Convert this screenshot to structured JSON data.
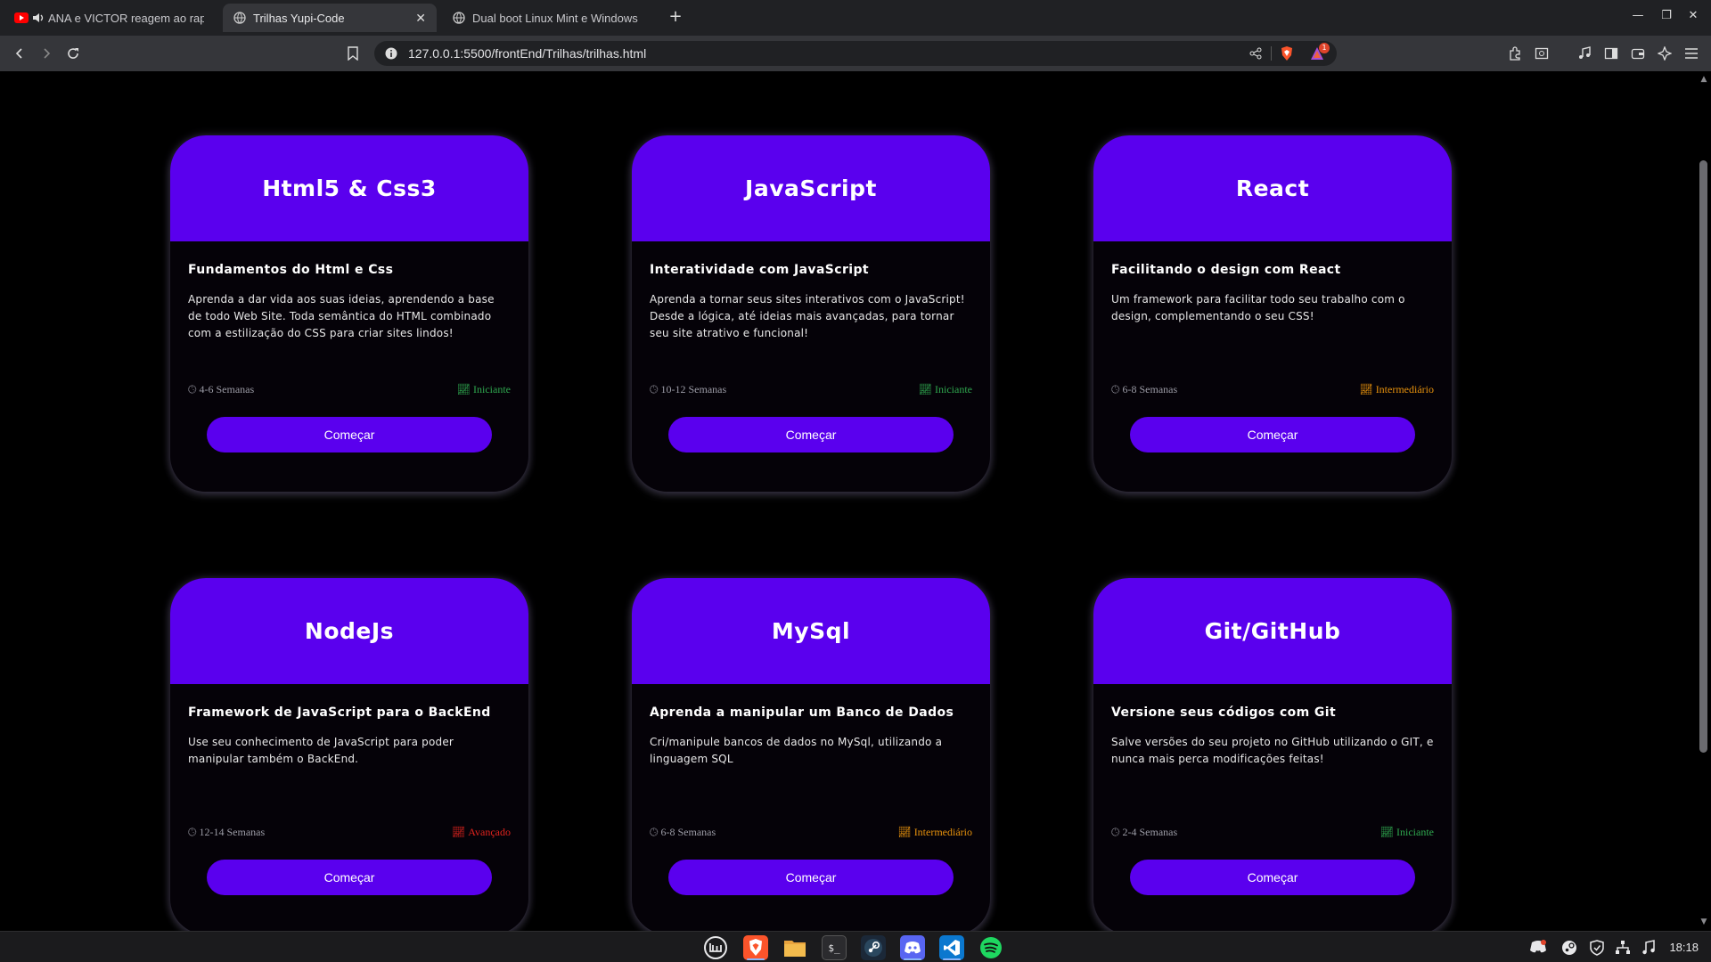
{
  "browser": {
    "tabs": [
      {
        "title": "ANA e VICTOR reagem ao rap",
        "active": false
      },
      {
        "title": "Trilhas Yupi-Code",
        "active": true
      },
      {
        "title": "Dual boot Linux Mint e Windows",
        "active": false
      }
    ],
    "url": "127.0.0.1:5500/frontEnd/Trilhas/trilhas.html",
    "brave_notifications": "1"
  },
  "cards": [
    {
      "title": "Html5 & Css3",
      "subtitle": "Fundamentos do Html e Css",
      "description": "Aprenda a dar vida aos suas ideias, aprendendo a base de todo Web Site. Toda semântica do HTML combinado com a estilização do CSS para criar sites lindos!",
      "duration": "4-6 Semanas",
      "level": "Iniciante",
      "level_color": "#2fa84f",
      "button": "Começar"
    },
    {
      "title": "JavaScript",
      "subtitle": "Interatividade com JavaScript",
      "description": "Aprenda a tornar seus sites interativos com o JavaScript! Desde a lógica, até ideias mais avançadas, para tornar seu site atrativo e funcional!",
      "duration": "10-12 Semanas",
      "level": "Iniciante",
      "level_color": "#2fa84f",
      "button": "Começar"
    },
    {
      "title": "React",
      "subtitle": "Facilitando o design com React",
      "description": "Um framework para facilitar todo seu trabalho com o design, complementando o seu CSS!",
      "duration": "6-8 Semanas",
      "level": "Intermediário",
      "level_color": "#e8920c",
      "button": "Começar"
    },
    {
      "title": "NodeJs",
      "subtitle": "Framework de JavaScript para o BackEnd",
      "description": "Use seu conhecimento de JavaScript para poder manipular também o BackEnd.",
      "duration": "12-14 Semanas",
      "level": "Avançado",
      "level_color": "#e0231d",
      "button": "Começar"
    },
    {
      "title": "MySql",
      "subtitle": "Aprenda a manipular um Banco de Dados",
      "description": "Cri/manipule bancos de dados no MySql, utilizando a linguagem SQL",
      "duration": "6-8 Semanas",
      "level": "Intermediário",
      "level_color": "#e8920c",
      "button": "Começar"
    },
    {
      "title": "Git/GitHub",
      "subtitle": "Versione seus códigos com Git",
      "description": "Salve versões do seu projeto no GitHub utilizando o GIT, e nunca mais perca modificações feitas!",
      "duration": "2-4 Semanas",
      "level": "Iniciante",
      "level_color": "#2fa84f",
      "button": "Começar"
    }
  ],
  "taskbar": {
    "clock": "18:18"
  }
}
